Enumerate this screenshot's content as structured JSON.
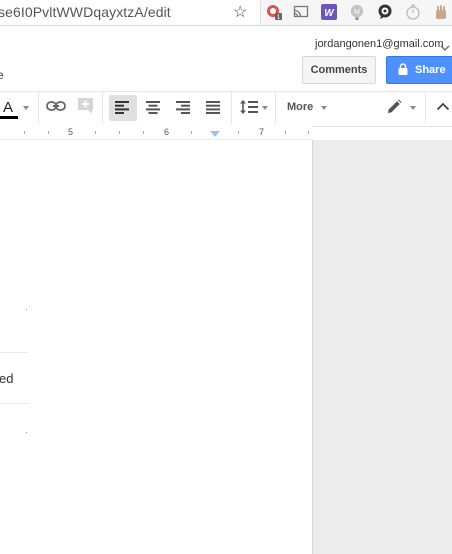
{
  "browser": {
    "url_fragment": "se6I0PvltWWDqayxtzA/edit",
    "bookmark_icon": "star-icon",
    "extensions": [
      {
        "name": "extension-red-badge-icon",
        "badge": "1",
        "color": "#d9534f"
      },
      {
        "name": "cast-icon",
        "color": "#777777"
      },
      {
        "name": "extension-purple-w-icon",
        "letter": "W",
        "color": "#6b57b8"
      },
      {
        "name": "extension-m-circle-icon",
        "letter": "M",
        "color": "#bbbbbb"
      },
      {
        "name": "chat-bubble-icon",
        "color": "#333333"
      },
      {
        "name": "timer-icon",
        "color": "#bbbbbb"
      },
      {
        "name": "extension-hand-icon",
        "color": "#c8a98d"
      }
    ]
  },
  "header": {
    "account_email": "jordangonen1@gmail.com",
    "file_menu_stub": "e",
    "comments_label": "Comments",
    "share_label": "Share",
    "share_color": "#4d90fe"
  },
  "toolbar": {
    "text_color_letter": "A",
    "more_label": "More"
  },
  "ruler": {
    "numbers": [
      "5",
      "6",
      "7"
    ]
  },
  "page": {
    "partial_word": "ed"
  }
}
